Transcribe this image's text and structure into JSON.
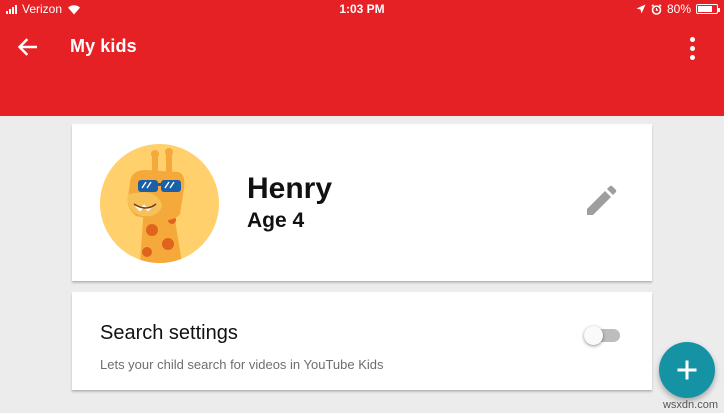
{
  "status_bar": {
    "carrier": "Verizon",
    "time": "1:03 PM",
    "battery": "80%",
    "battery_level": 0.8,
    "icons": [
      "signal-icon",
      "wifi-icon",
      "location-icon",
      "alarm-icon",
      "battery-icon"
    ]
  },
  "app_bar": {
    "title": "My kids",
    "background_color": "#e62126",
    "icons": [
      "back-arrow-icon",
      "more-vert-icon"
    ]
  },
  "profile": {
    "name": "Henry",
    "age": "Age 4",
    "avatar_icon": "giraffe-with-sunglasses",
    "avatar_bg": "#ffd06b"
  },
  "settings": {
    "title": "Search settings",
    "description": "Lets your child search for videos in YouTube Kids",
    "enabled": false
  },
  "fab": {
    "icon": "plus-icon",
    "color": "#1593a5"
  },
  "watermark": "wsxdn.com"
}
